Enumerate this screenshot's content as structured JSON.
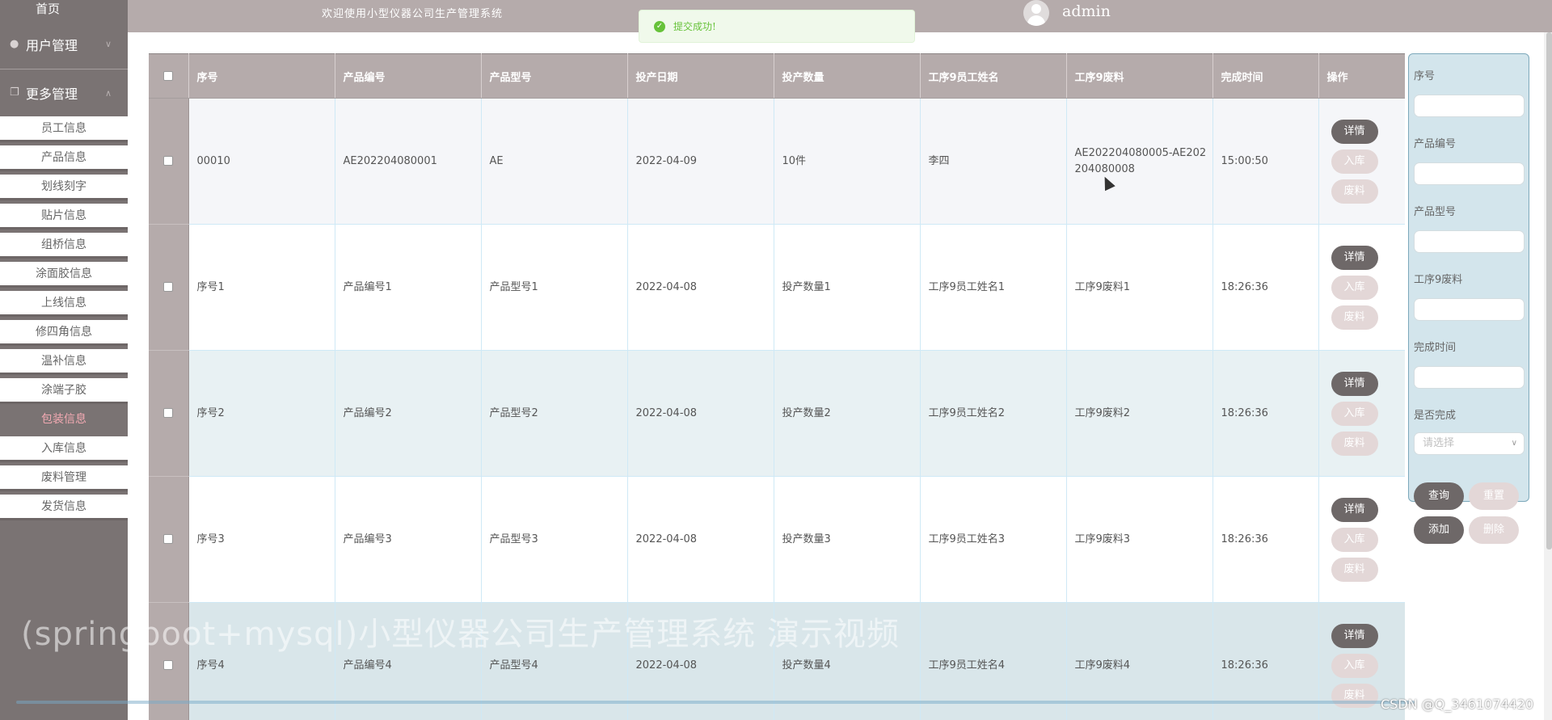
{
  "sidebar": {
    "home": "首页",
    "groups": [
      {
        "label": "用户管理",
        "icon": "user-icon"
      },
      {
        "label": "更多管理",
        "icon": "copy-icon"
      }
    ],
    "items": [
      "员工信息",
      "产品信息",
      "划线刻字",
      "贴片信息",
      "组桥信息",
      "涂面胶信息",
      "上线信息",
      "修四角信息",
      "温补信息",
      "涂端子胶",
      "包装信息",
      "入库信息",
      "废料管理",
      "发货信息"
    ],
    "active_item": "包装信息"
  },
  "header": {
    "welcome": "欢迎使用小型仪器公司生产管理系统",
    "username": "admin"
  },
  "toast": {
    "message": "提交成功!"
  },
  "table": {
    "columns": [
      "序号",
      "产品编号",
      "产品型号",
      "投产日期",
      "投产数量",
      "工序9员工姓名",
      "工序9废料",
      "完成时间",
      "操作"
    ],
    "rows": [
      [
        "00010",
        "AE202204080001",
        "AE",
        "2022-04-09",
        "10件",
        "李四",
        "AE202204080005-AE202204080008",
        "15:00:50"
      ],
      [
        "序号1",
        "产品编号1",
        "产品型号1",
        "2022-04-08",
        "投产数量1",
        "工序9员工姓名1",
        "工序9废料1",
        "18:26:36"
      ],
      [
        "序号2",
        "产品编号2",
        "产品型号2",
        "2022-04-08",
        "投产数量2",
        "工序9员工姓名2",
        "工序9废料2",
        "18:26:36"
      ],
      [
        "序号3",
        "产品编号3",
        "产品型号3",
        "2022-04-08",
        "投产数量3",
        "工序9员工姓名3",
        "工序9废料3",
        "18:26:36"
      ],
      [
        "序号4",
        "产品编号4",
        "产品型号4",
        "2022-04-08",
        "投产数量4",
        "工序9员工姓名4",
        "工序9废料4",
        "18:26:36"
      ]
    ],
    "row_actions": [
      "详情",
      "入库",
      "废料"
    ]
  },
  "search_panel": {
    "fields": [
      "序号",
      "产品编号",
      "产品型号",
      "工序9废料",
      "完成时间"
    ],
    "select_label": "是否完成",
    "select_placeholder": "请选择",
    "buttons": {
      "query": "查询",
      "reset": "重置",
      "add": "添加",
      "delete": "删除"
    }
  },
  "overlay": {
    "video_title": "(springboot+mysql)小型仪器公司生产管理系统 演示视频",
    "watermark": "CSDN @Q_3461074420"
  },
  "colors": {
    "sidebar_bg": "#7a7373",
    "header_bg": "#b5abab",
    "accent_dark": "#6e6868",
    "accent_light": "#e3d7d7",
    "active_text": "#f2a9b2",
    "success": "#67c23a"
  }
}
